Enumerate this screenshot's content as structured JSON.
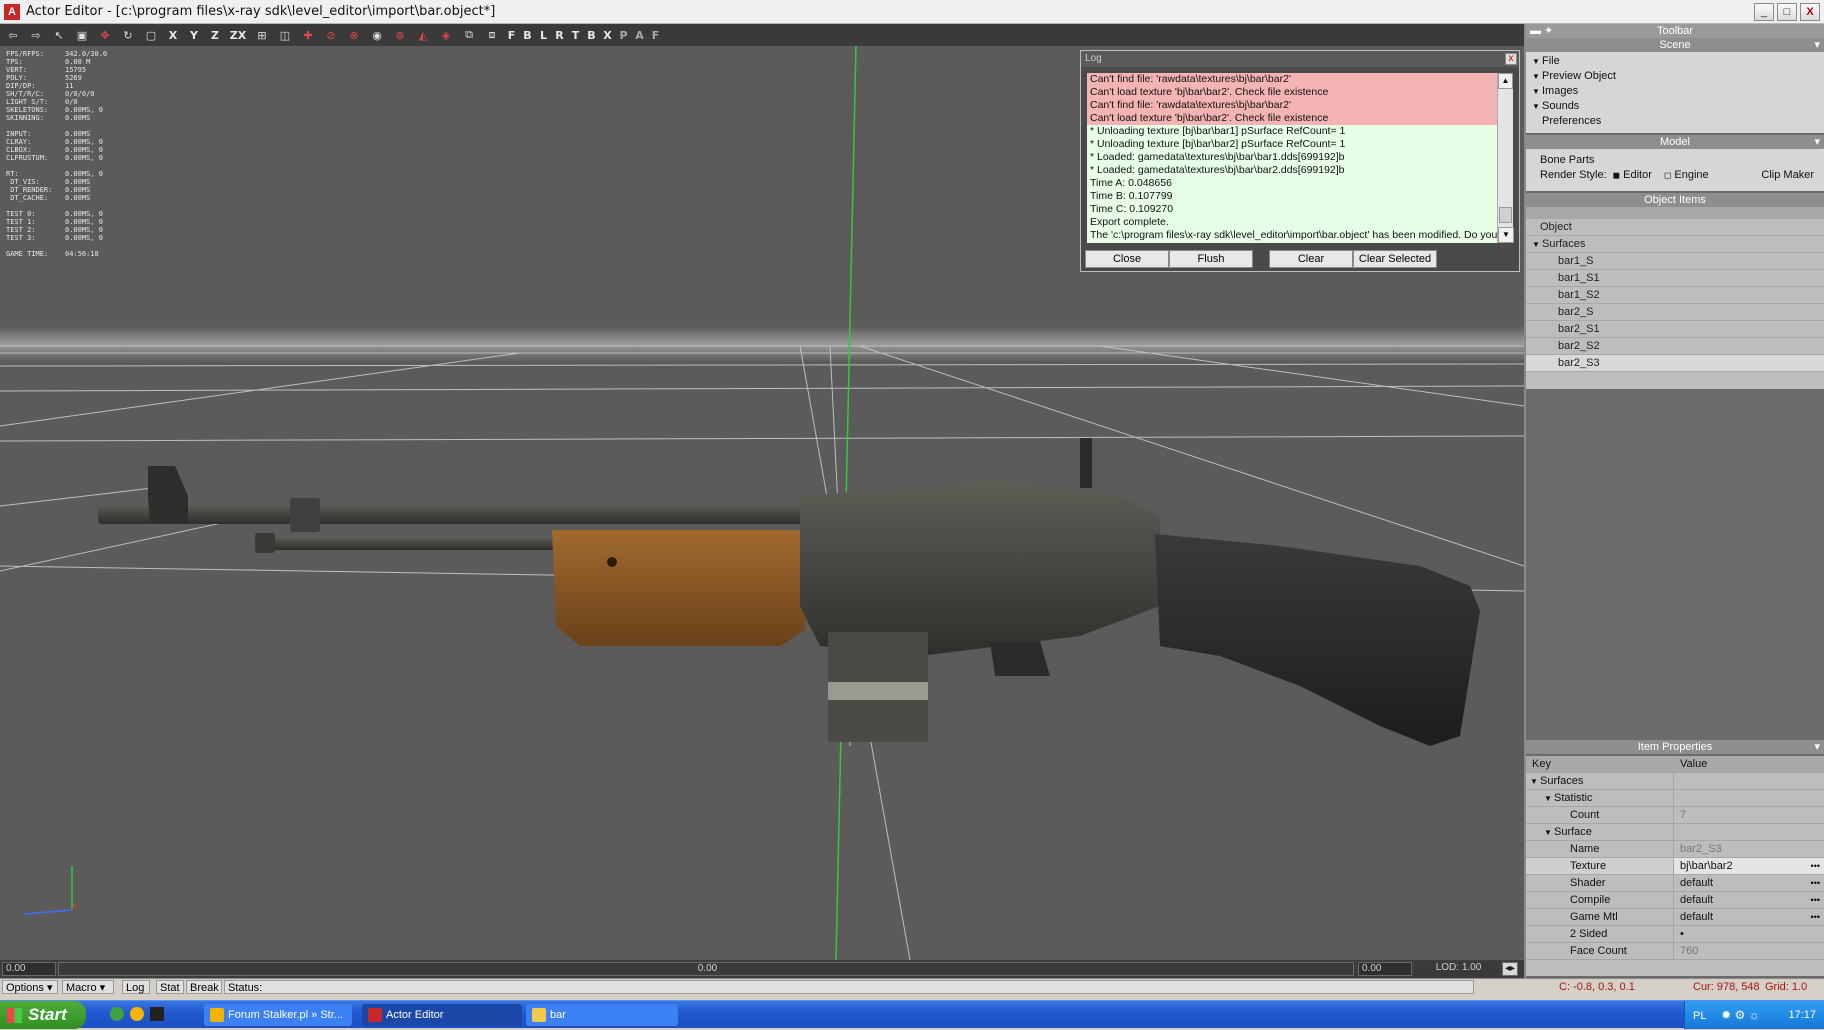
{
  "window": {
    "title": "Actor Editor - [c:\\program files\\x-ray sdk\\level_editor\\import\\bar.object*]",
    "minimize": "_",
    "maximize": "□",
    "close": "X"
  },
  "toolbar": {
    "axis_labels": [
      "X",
      "Y",
      "Z",
      "ZX"
    ],
    "letter_labels": [
      "F",
      "B",
      "L",
      "R",
      "T",
      "B",
      "X",
      "P",
      "A",
      "F"
    ]
  },
  "stats": {
    "text": "FPS/RFPS:     342.0/30.0\nTPS:          0.00 M\nVERT:         15795\nPOLY:         5269\nDIP/DP:       11\nSH/T/R/C:     0/0/0/0\nLIGHT S/T:    0/0\nSKELETONS:    0.00MS, 0\nSKINNING:     0.00MS\n\nINPUT:        0.00MS\nCLRAY:        0.00MS, 0\nCLBOX:        0.00MS, 0\nCLFRUSTUM:    0.00MS, 0\n\nRT:           0.00MS, 0\n DT_VIS:      0.00MS\n DT_RENDER:   0.00MS\n DT_CACHE:    0.00MS\n\nTEST 0:       0.00MS, 0\nTEST 1:       0.00MS, 0\nTEST 2:       0.00MS, 0\nTEST 3:       0.00MS, 0\n\nGAME TIME:    04:56:18"
  },
  "log": {
    "title": "Log",
    "close_glyph": "x",
    "lines": [
      {
        "text": "Can't find file: 'rawdata\\textures\\bj\\bar\\bar2'",
        "kind": "error"
      },
      {
        "text": "Can't load texture 'bj\\bar\\bar2'. Check file existence",
        "kind": "error"
      },
      {
        "text": "Can't find file: 'rawdata\\textures\\bj\\bar\\bar2'",
        "kind": "error"
      },
      {
        "text": "Can't load texture 'bj\\bar\\bar2'. Check file existence",
        "kind": "error"
      },
      {
        "text": "* Unloading texture [bj\\bar\\bar1] pSurface RefCount= 1",
        "kind": "info"
      },
      {
        "text": "* Unloading texture [bj\\bar\\bar2] pSurface RefCount= 1",
        "kind": "info"
      },
      {
        "text": "* Loaded: gamedata\\textures\\bj\\bar\\bar1.dds[699192]b",
        "kind": "info"
      },
      {
        "text": "* Loaded: gamedata\\textures\\bj\\bar\\bar2.dds[699192]b",
        "kind": "info"
      },
      {
        "text": "Time A:  0.048656",
        "kind": "info"
      },
      {
        "text": "Time B:  0.107799",
        "kind": "info"
      },
      {
        "text": "Time C:  0.109270",
        "kind": "info"
      },
      {
        "text": "Export complete.",
        "kind": "info"
      },
      {
        "text": "The 'c:\\program files\\x-ray sdk\\level_editor\\import\\bar.object' has been modified. Do you",
        "kind": "info"
      }
    ],
    "buttons": {
      "close": "Close",
      "flush": "Flush",
      "clear": "Clear",
      "clear_selected": "Clear Selected"
    }
  },
  "right_panel": {
    "toolbar_header": "Toolbar",
    "scene_header": "Scene",
    "scene_items": [
      "File",
      "Preview Object",
      "Images",
      "Sounds",
      "Preferences"
    ],
    "model_header": "Model",
    "bone_parts": "Bone Parts",
    "render_style_label": "Render Style:",
    "editor_label": "Editor",
    "engine_label": "Engine",
    "clip_maker": "Clip Maker",
    "object_items_header": "Object Items",
    "object_root": "Object",
    "surfaces_node": "Surfaces",
    "surfaces": [
      "bar1_S",
      "bar1_S1",
      "bar1_S2",
      "bar2_S",
      "bar2_S1",
      "bar2_S2",
      "bar2_S3"
    ],
    "item_properties_header": "Item Properties",
    "props_key_col": "Key",
    "props_val_col": "Value",
    "props": {
      "surfaces": "Surfaces",
      "statistic": "Statistic",
      "count_key": "Count",
      "count_val": "7",
      "surface": "Surface",
      "name_key": "Name",
      "name_val": "bar2_S3",
      "texture_key": "Texture",
      "texture_val": "bj\\bar\\bar2",
      "shader_key": "Shader",
      "shader_val": "default",
      "compile_key": "Compile",
      "compile_val": "default",
      "gamemtl_key": "Game Mtl",
      "gamemtl_val": "default",
      "sided_key": "2 Sided",
      "sided_val": "•",
      "facecount_key": "Face Count",
      "facecount_val": "760"
    }
  },
  "timebar": {
    "left_value": "0.00",
    "center_value": "0.00",
    "right_value": "0.00",
    "lod": "LOD: 1.00"
  },
  "statusbar": {
    "options": "Options",
    "macro": "Macro",
    "log": "Log",
    "stat": "Stat",
    "break": "Break",
    "status": "Status:",
    "coords": "C: -0.8, 0.3, 0.1",
    "cursor": "Cur: 978, 548",
    "grid": "Grid: 1.0"
  },
  "taskbar": {
    "start": "Start",
    "tasks": [
      {
        "label": "Forum Stalker.pl » Str...",
        "icon_color": "#f4b400"
      },
      {
        "label": "Actor Editor",
        "icon_color": "#c62828"
      },
      {
        "label": "bar",
        "icon_color": "#f2c94c"
      }
    ],
    "lang": "PL",
    "clock": "17:17"
  },
  "colors": {
    "viewport_bg": "#5b5b5b",
    "log_error_bg": "#f4b4b4",
    "log_info_bg": "#e6ffe6",
    "green_axis": "#37c837"
  }
}
